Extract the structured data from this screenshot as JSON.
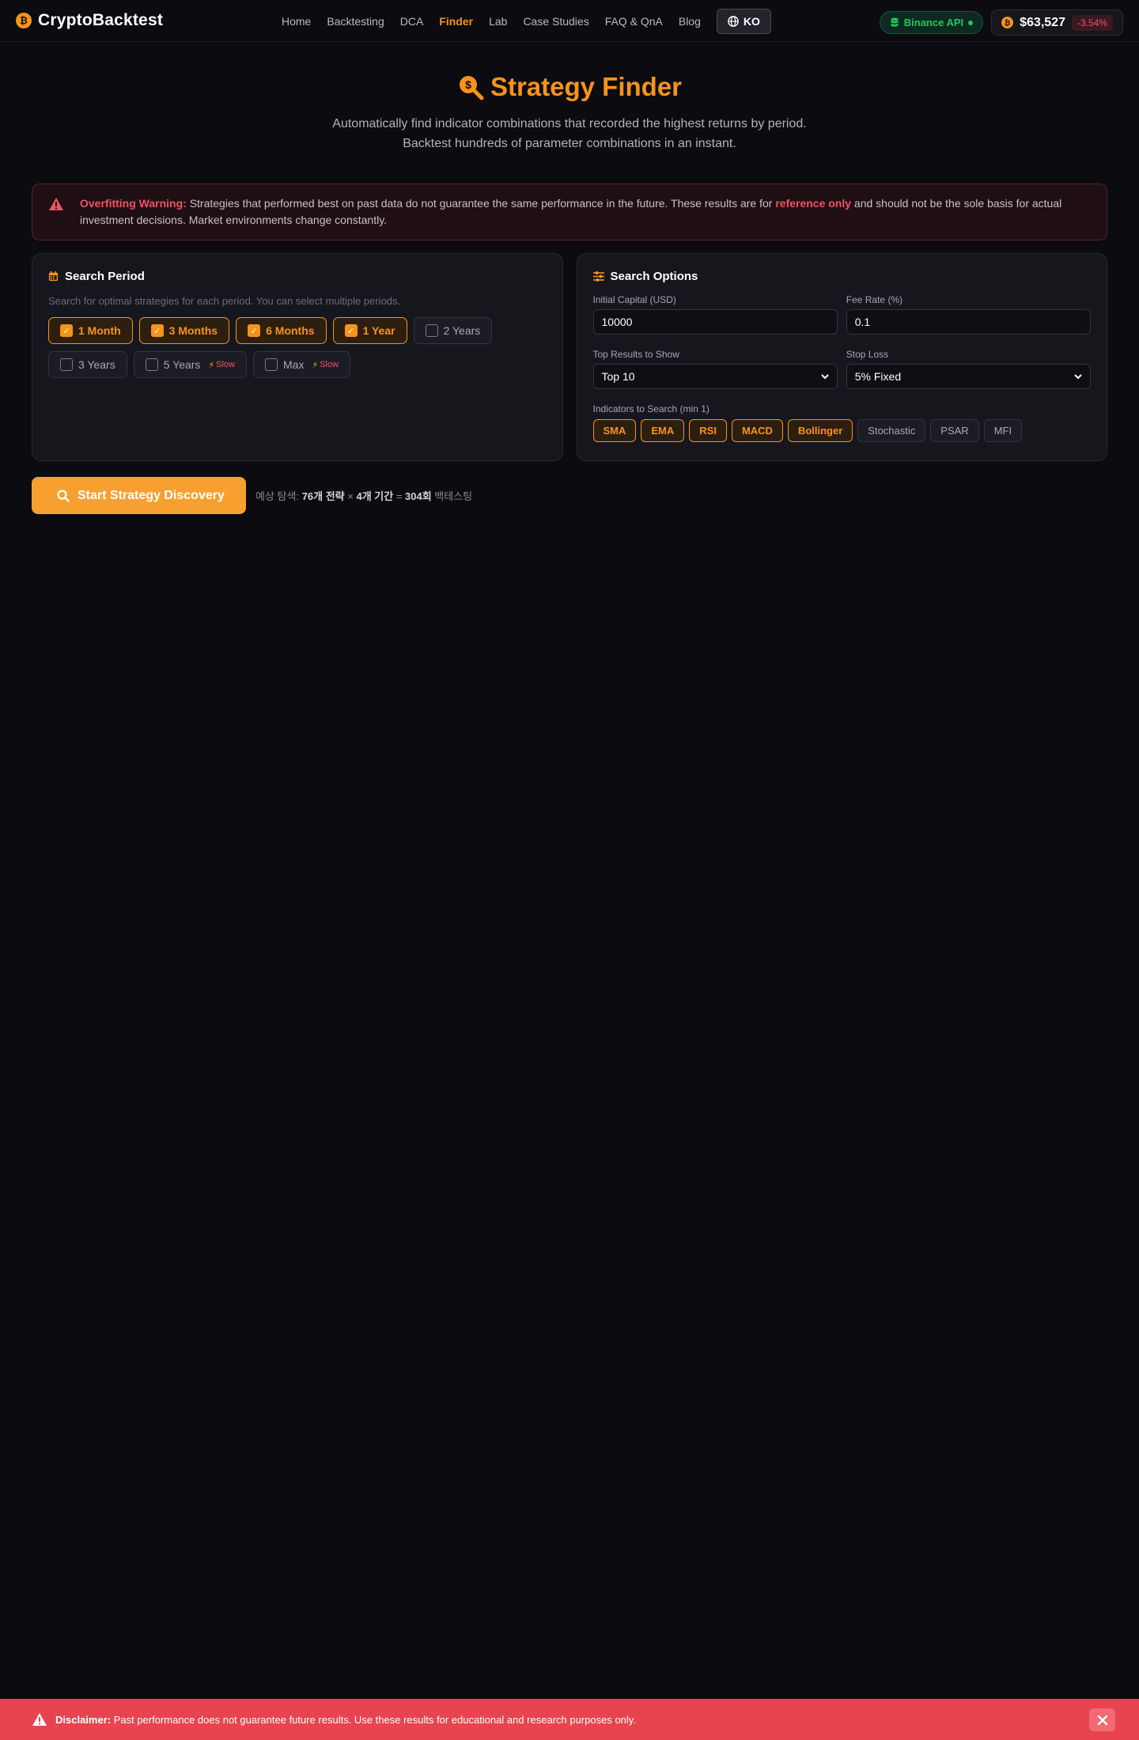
{
  "nav": {
    "logo_text": "CryptoBacktest",
    "logo_icon": "bitcoin-icon",
    "links": [
      "Home",
      "Backtesting",
      "DCA",
      "Finder",
      "Lab",
      "Case Studies",
      "FAQ & QnA",
      "Blog"
    ],
    "active_link": "Finder",
    "lang_label": "KO",
    "api_label": "Binance API",
    "price": "$63,527",
    "price_change": "-3.54%",
    "colors": {
      "accent": "#f7931a",
      "negative": "#f05264",
      "positive": "#22c55e"
    }
  },
  "hero": {
    "title": "Strategy Finder",
    "subtitle_line1": "Automatically find indicator combinations that recorded the highest returns by period.",
    "subtitle_line2": "Backtest hundreds of parameter combinations in an instant."
  },
  "warning": {
    "label": "Overfitting Warning:",
    "text_before": " Strategies that performed best on past data do not guarantee the same performance in the future. These results are for ",
    "highlight": "reference only",
    "text_after": " and should not be the sole basis for actual investment decisions. Market environments change constantly."
  },
  "period_panel": {
    "title": "Search Period",
    "description": "Search for optimal strategies for each period. You can select multiple periods.",
    "periods": [
      {
        "label": "1 Month",
        "checked": true
      },
      {
        "label": "3 Months",
        "checked": true
      },
      {
        "label": "6 Months",
        "checked": true
      },
      {
        "label": "1 Year",
        "checked": true
      },
      {
        "label": "2 Years",
        "checked": false
      },
      {
        "label": "3 Years",
        "checked": false
      },
      {
        "label": "5 Years",
        "checked": false,
        "badge": "Slow"
      },
      {
        "label": "Max",
        "checked": false,
        "badge": "Slow"
      }
    ],
    "checkmark": "✓"
  },
  "options_panel": {
    "title": "Search Options",
    "capital_label": "Initial Capital (USD)",
    "capital_value": "10000",
    "fee_label": "Fee Rate (%)",
    "fee_value": "0.1",
    "top_label": "Top Results to Show",
    "top_value": "Top 10",
    "stop_label": "Stop Loss",
    "stop_value": "5% Fixed",
    "indicators_label": "Indicators to Search (min 1)",
    "indicators": [
      {
        "label": "SMA",
        "selected": true
      },
      {
        "label": "EMA",
        "selected": true
      },
      {
        "label": "RSI",
        "selected": true
      },
      {
        "label": "MACD",
        "selected": true
      },
      {
        "label": "Bollinger",
        "selected": true
      },
      {
        "label": "Stochastic",
        "selected": false
      },
      {
        "label": "PSAR",
        "selected": false
      },
      {
        "label": "MFI",
        "selected": false
      }
    ]
  },
  "action": {
    "button_label": "Start Strategy Discovery",
    "estimate_prefix": "예상 탐색: ",
    "strategies": "76개 전략",
    "times": " × ",
    "periods": "4개 기간",
    "equals": " = ",
    "total": "304회",
    "suffix": " 백테스팅"
  },
  "disclaimer": {
    "label": "Disclaimer:",
    "text": " Past performance does not guarantee future results. Use these results for educational and research purposes only."
  }
}
